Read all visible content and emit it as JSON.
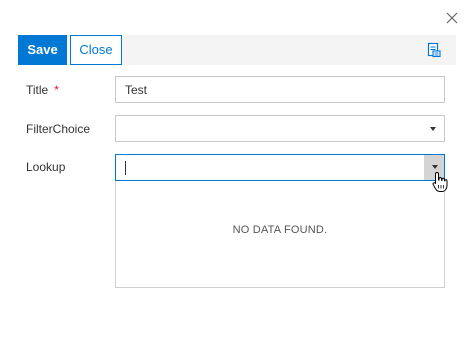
{
  "dialog": {
    "close_icon": "close-icon"
  },
  "toolbar": {
    "save_label": "Save",
    "close_label": "Close",
    "right_icon": "form-settings-icon",
    "accent_color": "#0078d4"
  },
  "form": {
    "title": {
      "label": "Title",
      "required_marker": "*",
      "value": "Test"
    },
    "filter_choice": {
      "label": "FilterChoice",
      "value": ""
    },
    "lookup": {
      "label": "Lookup",
      "value": "",
      "dropdown_empty_text": "NO DATA FOUND."
    }
  }
}
